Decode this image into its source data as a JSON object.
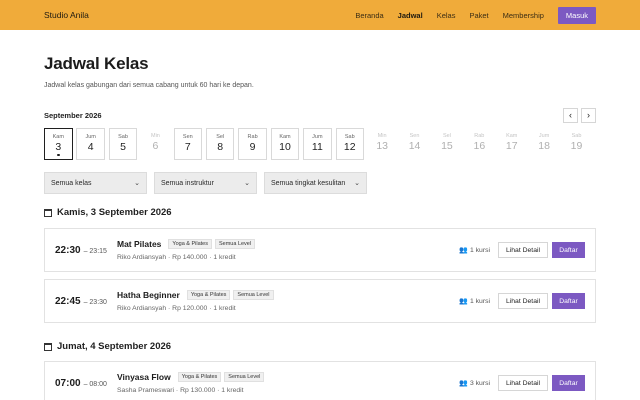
{
  "brand": "Studio Anila",
  "nav": {
    "items": [
      "Beranda",
      "Jadwal",
      "Kelas",
      "Paket",
      "Membership"
    ],
    "active_index": 1,
    "login_label": "Masuk"
  },
  "page": {
    "title": "Jadwal Kelas",
    "subtitle": "Jadwal kelas gabungan dari semua cabang untuk 60 hari ke depan."
  },
  "calendar": {
    "month_label": "September 2026",
    "prev_icon": "chevron-left-icon",
    "next_icon": "chevron-right-icon",
    "prev_glyph": "‹",
    "next_glyph": "›",
    "days": [
      {
        "name": "Kam",
        "num": "3",
        "enabled": true,
        "selected": true
      },
      {
        "name": "Jum",
        "num": "4",
        "enabled": true,
        "selected": false
      },
      {
        "name": "Sab",
        "num": "5",
        "enabled": true,
        "selected": false
      },
      {
        "name": "Min",
        "num": "6",
        "enabled": false,
        "selected": false
      },
      {
        "name": "Sen",
        "num": "7",
        "enabled": true,
        "selected": false
      },
      {
        "name": "Sel",
        "num": "8",
        "enabled": true,
        "selected": false
      },
      {
        "name": "Rab",
        "num": "9",
        "enabled": true,
        "selected": false
      },
      {
        "name": "Kam",
        "num": "10",
        "enabled": true,
        "selected": false
      },
      {
        "name": "Jum",
        "num": "11",
        "enabled": true,
        "selected": false
      },
      {
        "name": "Sab",
        "num": "12",
        "enabled": true,
        "selected": false
      },
      {
        "name": "Min",
        "num": "13",
        "enabled": false,
        "selected": false
      },
      {
        "name": "Sen",
        "num": "14",
        "enabled": false,
        "selected": false
      },
      {
        "name": "Sel",
        "num": "15",
        "enabled": false,
        "selected": false
      },
      {
        "name": "Rab",
        "num": "16",
        "enabled": false,
        "selected": false
      },
      {
        "name": "Kam",
        "num": "17",
        "enabled": false,
        "selected": false
      },
      {
        "name": "Jum",
        "num": "18",
        "enabled": false,
        "selected": false
      },
      {
        "name": "Sab",
        "num": "19",
        "enabled": false,
        "selected": false
      }
    ]
  },
  "filters": {
    "class_label": "Semua kelas",
    "instructor_label": "Semua instruktur",
    "level_label": "Semua tingkat kesulitan",
    "chevron_glyph": "⌄"
  },
  "schedule": {
    "calendar_icon": "calendar-icon",
    "people_icon": "people-icon",
    "people_glyph": "👥",
    "detail_label": "Lihat Detail",
    "register_label": "Daftar",
    "groups": [
      {
        "date_label": "Kamis, 3 September 2026",
        "sessions": [
          {
            "start": "22:30",
            "end": "– 23:15",
            "title": "Mat Pilates",
            "tags": [
              "Yoga & Pilates",
              "Semua Level"
            ],
            "meta": "Riko Ardiansyah · Rp 140.000 · 1 kredit",
            "slots": "1 kursi"
          },
          {
            "start": "22:45",
            "end": "– 23:30",
            "title": "Hatha Beginner",
            "tags": [
              "Yoga & Pilates",
              "Semua Level"
            ],
            "meta": "Riko Ardiansyah · Rp 120.000 · 1 kredit",
            "slots": "1 kursi"
          }
        ]
      },
      {
        "date_label": "Jumat, 4 September 2026",
        "sessions": [
          {
            "start": "07:00",
            "end": "– 08:00",
            "title": "Vinyasa Flow",
            "tags": [
              "Yoga & Pilates",
              "Semua Level"
            ],
            "meta": "Sasha Prameswari · Rp 130.000 · 1 kredit",
            "slots": "3 kursi"
          }
        ]
      }
    ]
  },
  "colors": {
    "topbar": "#f0ab3a",
    "accent": "#7c59c2"
  }
}
